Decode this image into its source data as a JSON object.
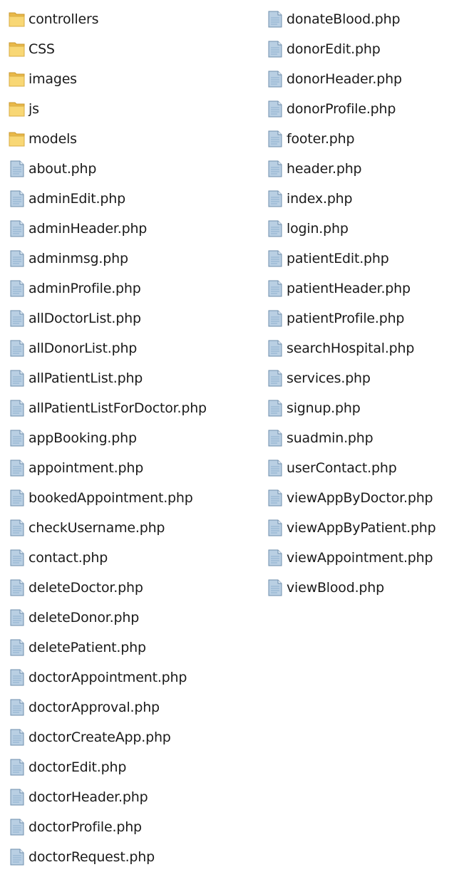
{
  "colors": {
    "folder_back": "#e9b949",
    "folder_front": "#f8d775",
    "file_body": "#b9cfe3",
    "file_edge": "#6f8fae",
    "file_fold": "#e3edf6",
    "text": "#1a1a1a"
  },
  "icons": {
    "folder": "folder-icon",
    "file": "php-file-icon"
  },
  "left_column": [
    {
      "name": "controllers",
      "type": "folder"
    },
    {
      "name": "CSS",
      "type": "folder"
    },
    {
      "name": "images",
      "type": "folder"
    },
    {
      "name": "js",
      "type": "folder"
    },
    {
      "name": "models",
      "type": "folder"
    },
    {
      "name": "about.php",
      "type": "file"
    },
    {
      "name": "adminEdit.php",
      "type": "file"
    },
    {
      "name": "adminHeader.php",
      "type": "file"
    },
    {
      "name": "adminmsg.php",
      "type": "file"
    },
    {
      "name": "adminProfile.php",
      "type": "file"
    },
    {
      "name": "allDoctorList.php",
      "type": "file"
    },
    {
      "name": "allDonorList.php",
      "type": "file"
    },
    {
      "name": "allPatientList.php",
      "type": "file"
    },
    {
      "name": "allPatientListForDoctor.php",
      "type": "file"
    },
    {
      "name": "appBooking.php",
      "type": "file"
    },
    {
      "name": "appointment.php",
      "type": "file"
    },
    {
      "name": "bookedAppointment.php",
      "type": "file"
    },
    {
      "name": "checkUsername.php",
      "type": "file"
    },
    {
      "name": "contact.php",
      "type": "file"
    },
    {
      "name": "deleteDoctor.php",
      "type": "file"
    },
    {
      "name": "deleteDonor.php",
      "type": "file"
    },
    {
      "name": "deletePatient.php",
      "type": "file"
    },
    {
      "name": "doctorAppointment.php",
      "type": "file"
    },
    {
      "name": "doctorApproval.php",
      "type": "file"
    },
    {
      "name": "doctorCreateApp.php",
      "type": "file"
    },
    {
      "name": "doctorEdit.php",
      "type": "file"
    },
    {
      "name": "doctorHeader.php",
      "type": "file"
    },
    {
      "name": "doctorProfile.php",
      "type": "file"
    },
    {
      "name": "doctorRequest.php",
      "type": "file"
    }
  ],
  "right_column": [
    {
      "name": "donateBlood.php",
      "type": "file"
    },
    {
      "name": "donorEdit.php",
      "type": "file"
    },
    {
      "name": "donorHeader.php",
      "type": "file"
    },
    {
      "name": "donorProfile.php",
      "type": "file"
    },
    {
      "name": "footer.php",
      "type": "file"
    },
    {
      "name": "header.php",
      "type": "file"
    },
    {
      "name": "index.php",
      "type": "file"
    },
    {
      "name": "login.php",
      "type": "file"
    },
    {
      "name": "patientEdit.php",
      "type": "file"
    },
    {
      "name": "patientHeader.php",
      "type": "file"
    },
    {
      "name": "patientProfile.php",
      "type": "file"
    },
    {
      "name": "searchHospital.php",
      "type": "file"
    },
    {
      "name": "services.php",
      "type": "file"
    },
    {
      "name": "signup.php",
      "type": "file"
    },
    {
      "name": "suadmin.php",
      "type": "file"
    },
    {
      "name": "userContact.php",
      "type": "file"
    },
    {
      "name": "viewAppByDoctor.php",
      "type": "file"
    },
    {
      "name": "viewAppByPatient.php",
      "type": "file"
    },
    {
      "name": "viewAppointment.php",
      "type": "file"
    },
    {
      "name": "viewBlood.php",
      "type": "file"
    }
  ]
}
